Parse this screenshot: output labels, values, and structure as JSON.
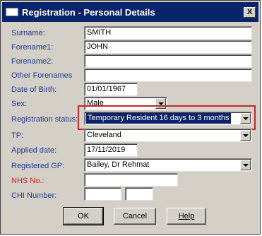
{
  "window": {
    "title": "Registration - Personal Details",
    "close_glyph": "X"
  },
  "form": {
    "surname": {
      "label": "Surname:",
      "value": "SMITH"
    },
    "forename1": {
      "label": "Forename1:",
      "value": "JOHN"
    },
    "forename2": {
      "label": "Forename2:",
      "value": ""
    },
    "other_forenames": {
      "label": "Other Forenames",
      "value": ""
    },
    "dob": {
      "label": "Date of Birth:",
      "value": "01/01/1967"
    },
    "sex": {
      "label": "Sex:",
      "value": "Male"
    },
    "registration_status": {
      "label": "Registration status:",
      "value": "Temporary Resident 16 days to 3 months"
    },
    "tp": {
      "label": "TP:",
      "value": "Cleveland"
    },
    "applied_date": {
      "label": "Applied date:",
      "value": "17/11/2019"
    },
    "registered_gp": {
      "label": "Registered GP:",
      "value": "Bailey, Dr Rehmat"
    },
    "nhs_no": {
      "label": "NHS No.:",
      "value": ""
    },
    "chi_number": {
      "label": "CHI Number:",
      "value_1": "",
      "value_2": ""
    }
  },
  "buttons": {
    "ok": "OK",
    "cancel": "Cancel",
    "help": "Help"
  },
  "colors": {
    "title_bar": "#0a246a",
    "label_text": "#1f3a8f",
    "required_label": "#cc2222",
    "highlight_box": "#c0282d"
  }
}
